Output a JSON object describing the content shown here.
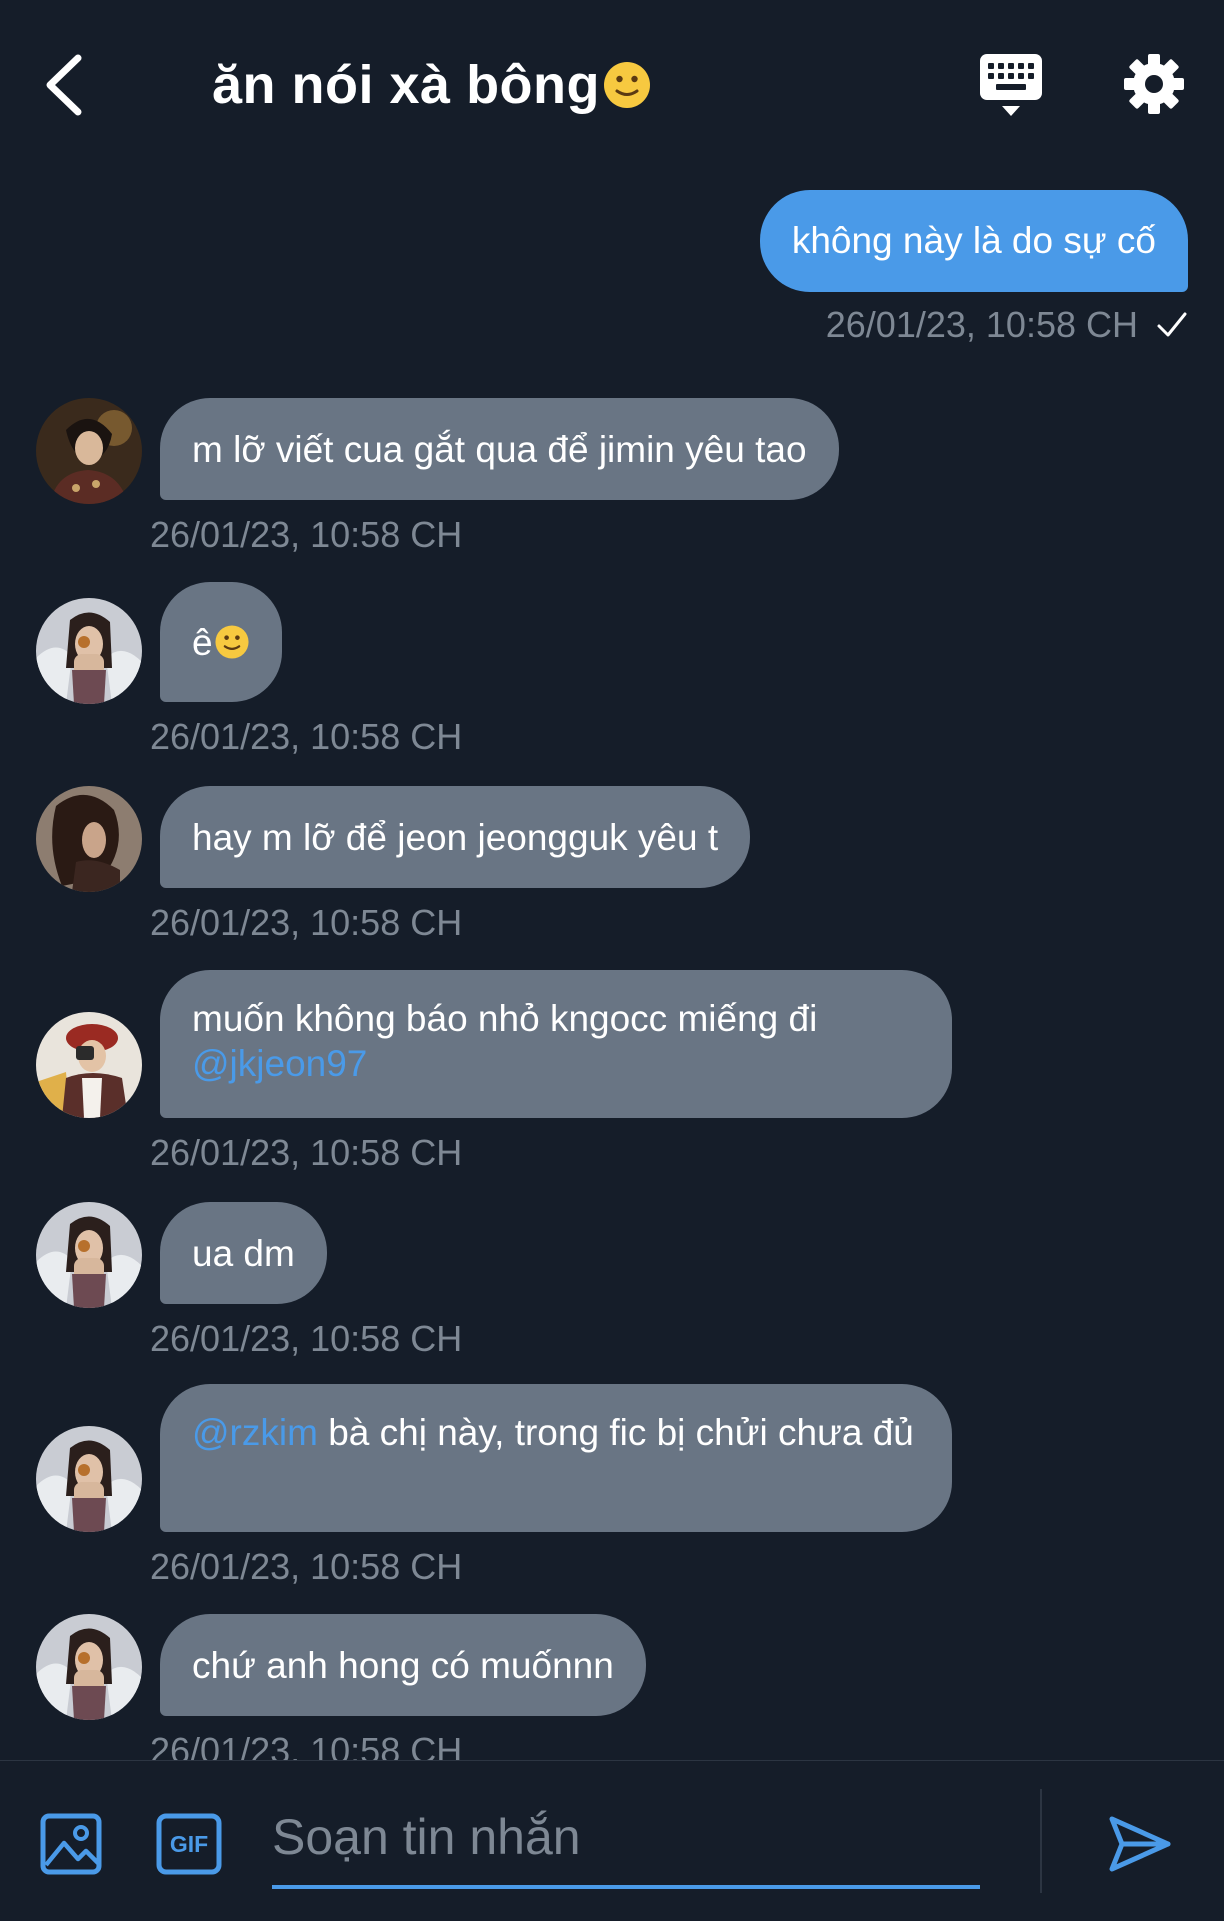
{
  "header": {
    "title": "ăn nói xà bông",
    "back_icon": "chevron-left-icon",
    "keyboard_icon": "keyboard-icon",
    "settings_icon": "gear-icon"
  },
  "messages": {
    "outgoing": {
      "text": "không này là do sự cố",
      "timestamp": "26/01/23, 10:58 CH"
    },
    "incoming": [
      {
        "text": "m lỡ viết cua gắt qua để jimin yêu tao",
        "timestamp": "26/01/23, 10:58 CH"
      },
      {
        "text": "ê",
        "timestamp": "26/01/23, 10:58 CH"
      },
      {
        "text": "hay m lỡ để jeon jeongguk yêu t",
        "timestamp": "26/01/23, 10:58 CH"
      },
      {
        "text": "muốn không báo nhỏ kngocc miếng đi",
        "mention": "@jkjeon97",
        "timestamp": "26/01/23, 10:58 CH"
      },
      {
        "text": "ua dm",
        "timestamp": "26/01/23, 10:58 CH"
      },
      {
        "mention": "@rzkim",
        "text": " bà chị này, trong fic bị chửi chưa đủ",
        "timestamp": "26/01/23, 10:58 CH"
      },
      {
        "text": "chứ anh hong có muốnnn",
        "timestamp": "26/01/23, 10:58 CH"
      }
    ]
  },
  "composer": {
    "placeholder": "Soạn tin nhắn",
    "gif_label": "GIF",
    "image_icon": "image-icon",
    "send_icon": "send-icon"
  },
  "colors": {
    "background": "#151d29",
    "accent": "#4a9ae8",
    "incoming_bubble": "#697584",
    "timestamp": "#7e8894"
  }
}
